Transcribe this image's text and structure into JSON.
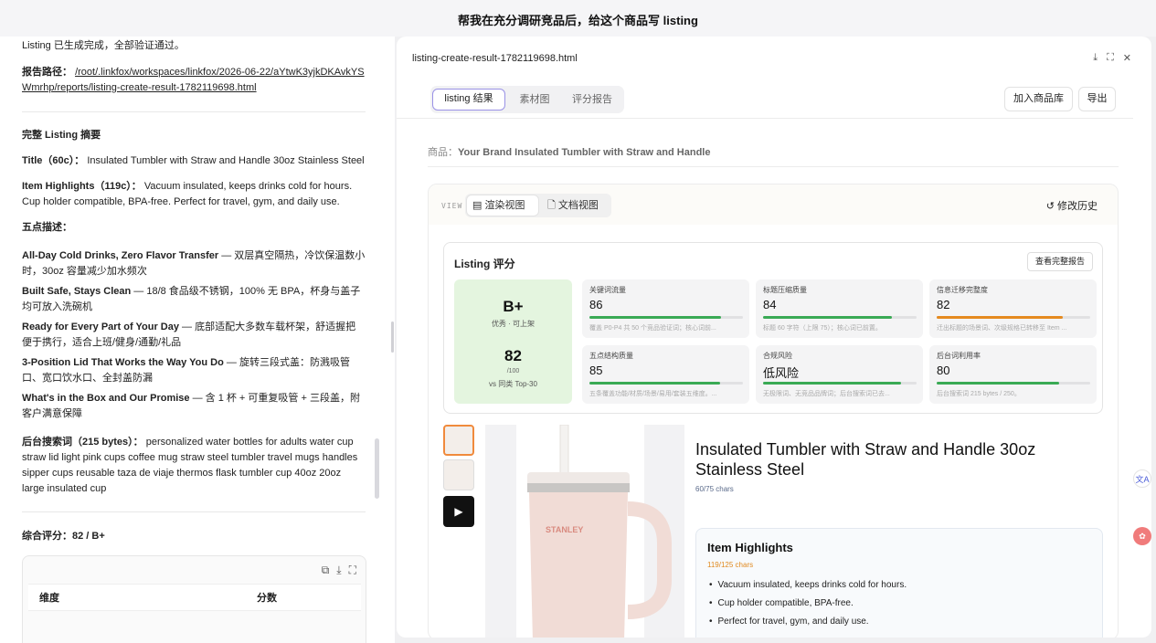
{
  "header": {
    "title": "帮我在充分调研竞品后，给这个商品写 listing"
  },
  "chat": {
    "status_line": "Listing 已生成完成，全部验证通过。",
    "report_label": "报告路径：",
    "report_path": "/root/.linkfox/workspaces/linkfox/2026-06-22/aYtwK3yjkDKAvkYSWmrhp/reports/listing-create-result-1782119698.html",
    "summary_heading": "完整 Listing 摘要",
    "title_label": "Title（60c）：",
    "title_value": "Insulated Tumbler with Straw and Handle 30oz Stainless Steel",
    "highlights_label": "Item Highlights（119c）：",
    "highlights_value": "Vacuum insulated, keeps drinks cold for hours. Cup holder compatible, BPA-free. Perfect for travel, gym, and daily use.",
    "bullets_heading": "五点描述：",
    "bullets": [
      {
        "title": "All-Day Cold Drinks, Zero Flavor Transfer",
        "text": " — 双层真空隔热，冷饮保温数小时，30oz 容量减少加水频次"
      },
      {
        "title": "Built Safe, Stays Clean",
        "text": " — 18/8 食品级不锈钢，100% 无 BPA，杯身与盖子均可放入洗碗机"
      },
      {
        "title": "Ready for Every Part of Your Day",
        "text": " — 底部适配大多数车载杯架，舒适握把便于携行，适合上班/健身/通勤/礼品"
      },
      {
        "title": "3-Position Lid That Works the Way You Do",
        "text": " — 旋转三段式盖：防溅吸管口、宽口饮水口、全封盖防漏"
      },
      {
        "title": "What's in the Box and Our Promise",
        "text": " — 含 1 杯 + 可重复吸管 + 三段盖，附客户满意保障"
      }
    ],
    "backend_label": "后台搜索词（215 bytes）：",
    "backend_value": "personalized water bottles for adults water cup straw lid light pink cups coffee mug straw steel tumbler travel mugs handles sipper cups reusable taza de viaje thermos flask tumbler cup 40oz 20oz large insulated cup",
    "overall_label": "综合评分：82 / B+",
    "table": {
      "col_dimension": "维度",
      "col_score": "分数"
    }
  },
  "panel": {
    "file_name": "listing-create-result-1782119698.html",
    "tabs": [
      {
        "label": "listing 结果",
        "active": true
      },
      {
        "label": "素材图",
        "active": false
      },
      {
        "label": "评分报告",
        "active": false
      }
    ],
    "add_button": "加入商品库",
    "export_button": "导出",
    "product_label": "商品：",
    "product_name": "Your Brand Insulated Tumbler with Straw and Handle",
    "view_label": "VIEW",
    "view_render": "渲染视图",
    "view_doc": "文档视图",
    "history": "修改历史",
    "score": {
      "title": "Listing 评分",
      "full_report": "查看完整报告",
      "grade": "B+",
      "grade_sub": "优秀 · 可上架",
      "total": "82",
      "total_of": "/100",
      "total_vs": "vs 同类 Top-30",
      "metrics": [
        {
          "name": "关键词流量",
          "value": "86",
          "fill": 0.86,
          "color": "#3aaa55",
          "desc": "覆盖 P0-P4 共 50 个竞品验证词；核心词前..."
        },
        {
          "name": "标题压缩质量",
          "value": "84",
          "fill": 0.84,
          "color": "#3aaa55",
          "desc": "标题 60 字符（上限 75）；核心词已前置。"
        },
        {
          "name": "信息迁移完整度",
          "value": "82",
          "fill": 0.82,
          "color": "#e58a1f",
          "desc": "迁出标题的场景词、次级规格已转移至 Item ..."
        },
        {
          "name": "五点结构质量",
          "value": "85",
          "fill": 0.85,
          "color": "#3aaa55",
          "desc": "五条覆盖功能/材质/场景/易用/套装五维度。..."
        },
        {
          "name": "合规风险",
          "value": "低风险",
          "fill": 0.9,
          "color": "#3aaa55",
          "desc": "无极限词、无竞品品牌词；后台搜索词已去..."
        },
        {
          "name": "后台词利用率",
          "value": "80",
          "fill": 0.8,
          "color": "#3aaa55",
          "desc": "后台搜索词 215 bytes / 250。"
        }
      ]
    },
    "product": {
      "brand_mark": "STANLEY",
      "title": "Insulated Tumbler with Straw and Handle 30oz Stainless Steel",
      "chars": "60/75 chars",
      "highlights_title": "Item Highlights",
      "highlights_chars": "119/125 chars",
      "highlights": [
        "Vacuum insulated, keeps drinks cold for hours.",
        "Cup holder compatible, BPA-free.",
        "Perfect for travel, gym, and daily use."
      ]
    }
  }
}
